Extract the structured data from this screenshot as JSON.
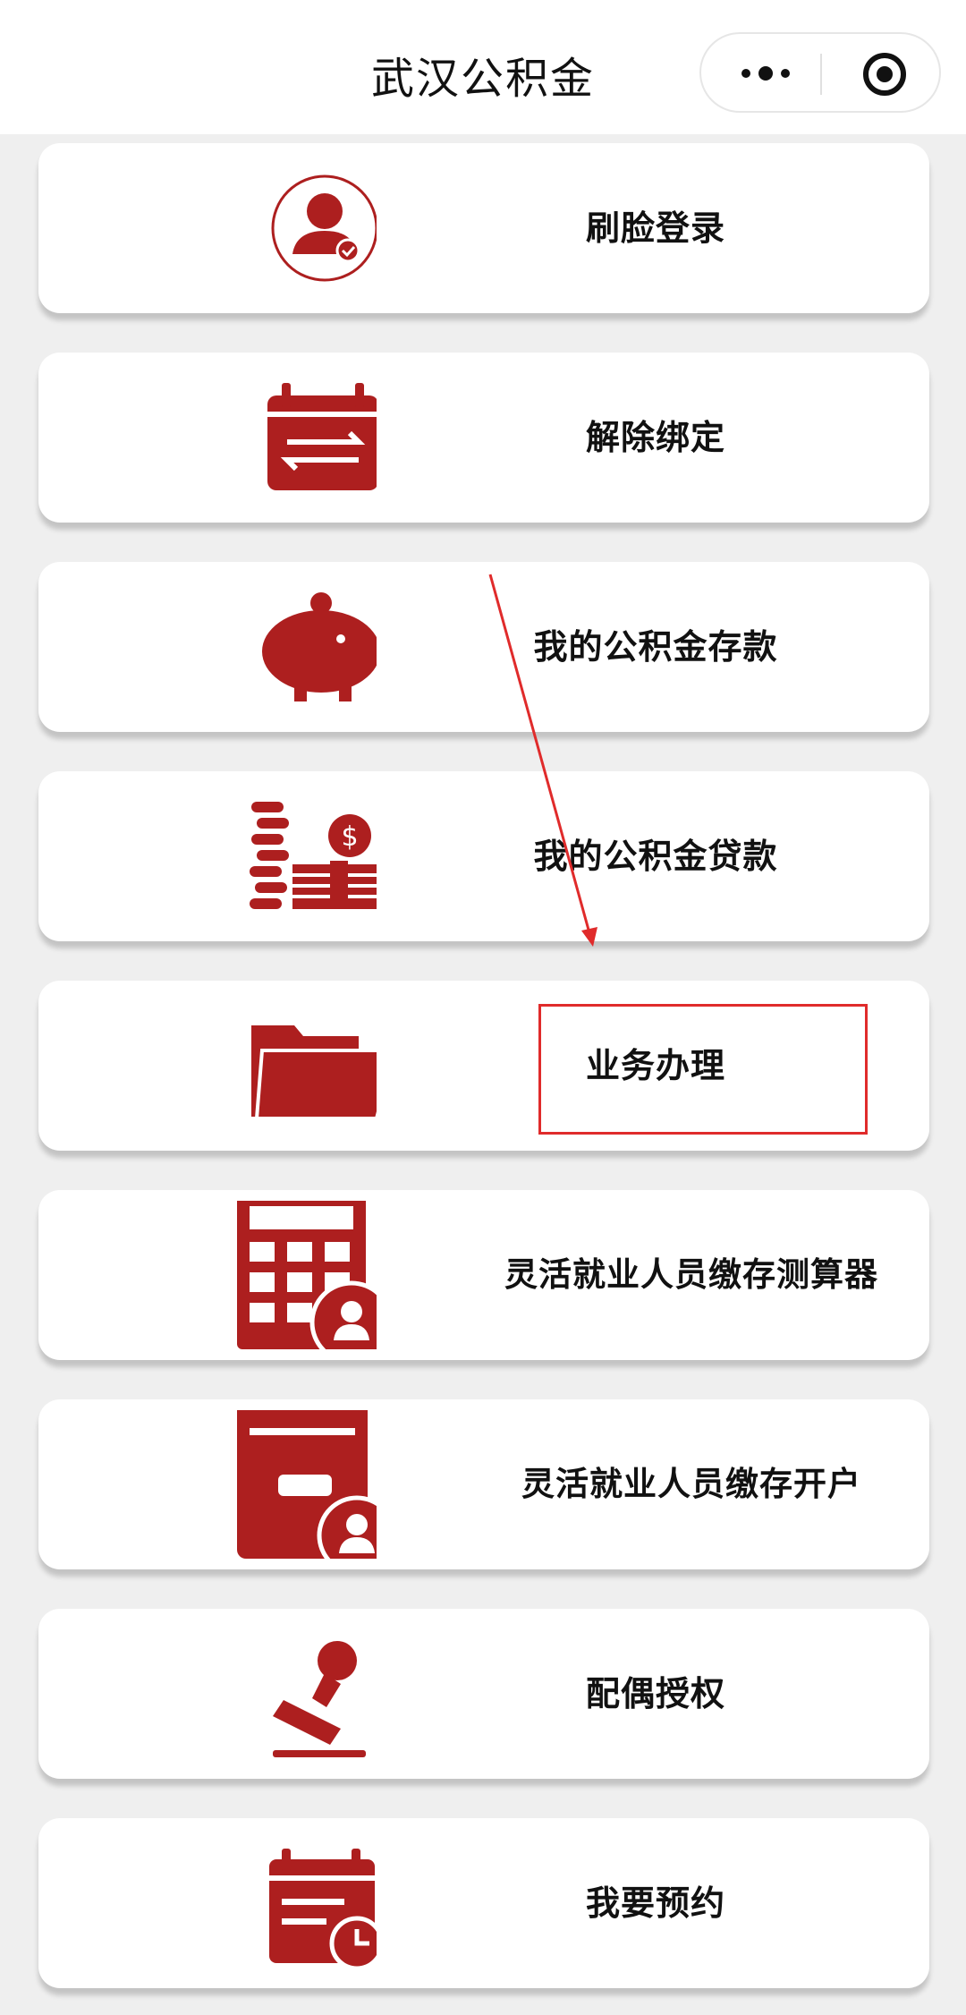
{
  "nav": {
    "title": "武汉公积金"
  },
  "menu": {
    "items": [
      {
        "label": "刷脸登录",
        "icon": "face-login-icon"
      },
      {
        "label": "解除绑定",
        "icon": "unbind-calendar-icon"
      },
      {
        "label": "我的公积金存款",
        "icon": "piggy-bank-icon"
      },
      {
        "label": "我的公积金贷款",
        "icon": "coins-money-icon"
      },
      {
        "label": "业务办理",
        "icon": "folder-icon"
      },
      {
        "label": "灵活就业人员缴存测算器",
        "icon": "calculator-user-icon"
      },
      {
        "label": "灵活就业人员缴存开户",
        "icon": "box-user-icon"
      },
      {
        "label": "配偶授权",
        "icon": "stamp-icon"
      },
      {
        "label": "我要预约",
        "icon": "calendar-clock-icon"
      }
    ]
  },
  "colors": {
    "accent": "#ad1f1f",
    "annotation": "#e02b2b",
    "background": "#efefef"
  }
}
